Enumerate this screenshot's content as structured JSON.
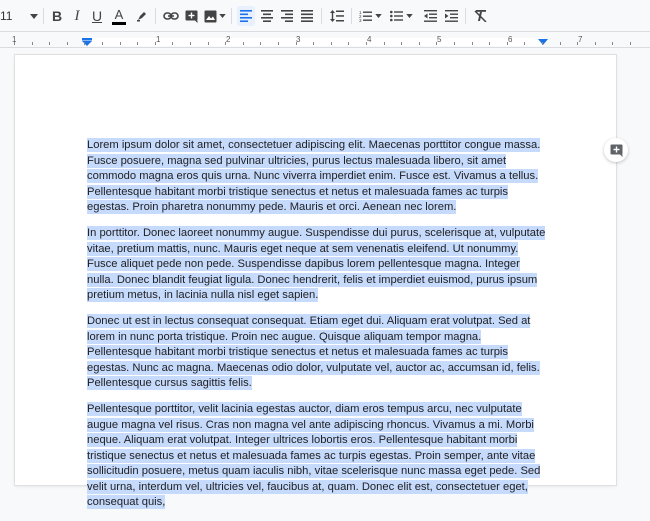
{
  "toolbar": {
    "font_size": "11",
    "text_color": "#000000",
    "accent": "#1a73e8",
    "buttons": [
      {
        "name": "font-size-menu",
        "icon": "chevron-down-icon"
      },
      {
        "name": "bold",
        "icon": "bold-icon"
      },
      {
        "name": "italic",
        "icon": "italic-icon"
      },
      {
        "name": "underline",
        "icon": "underline-icon"
      },
      {
        "name": "text-color",
        "icon": "text-color-icon"
      },
      {
        "name": "highlight-color",
        "icon": "highlighter-icon"
      },
      {
        "name": "insert-link",
        "icon": "link-icon"
      },
      {
        "name": "add-comment",
        "icon": "add-comment-icon"
      },
      {
        "name": "insert-image",
        "icon": "image-icon"
      },
      {
        "name": "align-left",
        "icon": "align-left-icon",
        "active": true
      },
      {
        "name": "align-center",
        "icon": "align-center-icon"
      },
      {
        "name": "align-right",
        "icon": "align-right-icon"
      },
      {
        "name": "align-justify",
        "icon": "align-justify-icon"
      },
      {
        "name": "line-spacing",
        "icon": "line-spacing-icon"
      },
      {
        "name": "numbered-list",
        "icon": "numbered-list-icon"
      },
      {
        "name": "bulleted-list",
        "icon": "bulleted-list-icon"
      },
      {
        "name": "decrease-indent",
        "icon": "decrease-indent-icon"
      },
      {
        "name": "increase-indent",
        "icon": "increase-indent-icon"
      },
      {
        "name": "clear-formatting",
        "icon": "clear-formatting-icon"
      }
    ]
  },
  "ruler": {
    "numbers": [
      "1",
      "1",
      "2",
      "3",
      "4",
      "5",
      "6",
      "7"
    ]
  },
  "document": {
    "selection_color": "#c6dafc",
    "paragraphs": [
      "Lorem ipsum dolor sit amet, consectetuer adipiscing elit. Maecenas porttitor congue massa. Fusce posuere, magna sed pulvinar ultricies, purus lectus malesuada libero, sit amet commodo magna eros quis urna. Nunc viverra imperdiet enim. Fusce est. Vivamus a tellus. Pellentesque habitant morbi tristique senectus et netus et malesuada fames ac turpis egestas. Proin pharetra nonummy pede. Mauris et orci. Aenean nec lorem.",
      "In porttitor. Donec laoreet nonummy augue. Suspendisse dui purus, scelerisque at, vulputate vitae, pretium mattis, nunc. Mauris eget neque at sem venenatis eleifend. Ut nonummy. Fusce aliquet pede non pede. Suspendisse dapibus lorem pellentesque magna. Integer nulla. Donec blandit feugiat ligula. Donec hendrerit, felis et imperdiet euismod, purus ipsum pretium metus, in lacinia nulla nisl eget sapien.",
      "Donec ut est in lectus consequat consequat. Etiam eget dui. Aliquam erat volutpat. Sed at lorem in nunc porta tristique. Proin nec augue. Quisque aliquam tempor magna. Pellentesque habitant morbi tristique senectus et netus et malesuada fames ac turpis egestas. Nunc ac magna. Maecenas odio dolor, vulputate vel, auctor ac, accumsan id, felis. Pellentesque cursus sagittis felis.",
      "Pellentesque porttitor, velit lacinia egestas auctor, diam eros tempus arcu, nec vulputate augue magna vel risus. Cras non magna vel ante adipiscing rhoncus. Vivamus a mi. Morbi neque. Aliquam erat volutpat. Integer ultrices lobortis eros. Pellentesque habitant morbi tristique senectus et netus et malesuada fames ac turpis egestas. Proin semper, ante vitae sollicitudin posuere, metus quam iaculis nibh, vitae scelerisque nunc massa eget pede. Sed velit urna, interdum vel, ultricies vel, faucibus at, quam. Donec elit est, consectetuer eget, consequat quis,"
    ]
  }
}
